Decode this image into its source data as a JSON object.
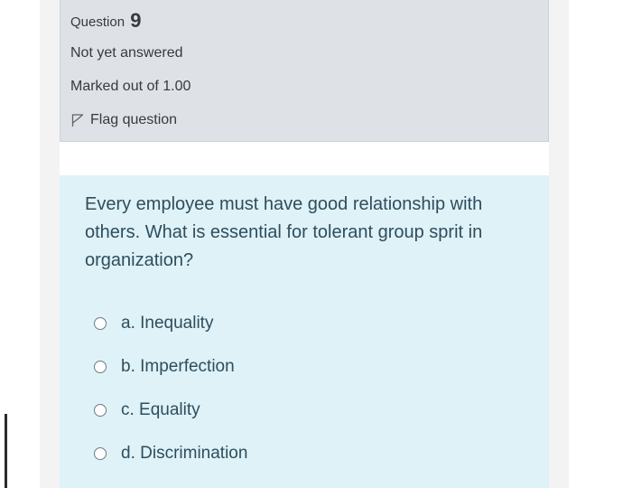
{
  "question_info": {
    "question_prefix": "Question",
    "question_number": "9",
    "state": "Not yet answered",
    "grade": "Marked out of 1.00",
    "flag_label": "Flag question",
    "flag_icon": "flag-icon"
  },
  "question": {
    "text": "Every employee must have good relationship with others. What is essential for tolerant group sprit in organization?",
    "answers": [
      {
        "label": "a. Inequality",
        "selected": false
      },
      {
        "label": "b. Imperfection",
        "selected": false
      },
      {
        "label": "c. Equality",
        "selected": false
      },
      {
        "label": "d. Discrimination",
        "selected": false
      }
    ]
  },
  "colors": {
    "info_background": "#dee2e6",
    "content_background": "#def2f8",
    "text": "#373a3c",
    "question_text": "#2f4d5c"
  }
}
